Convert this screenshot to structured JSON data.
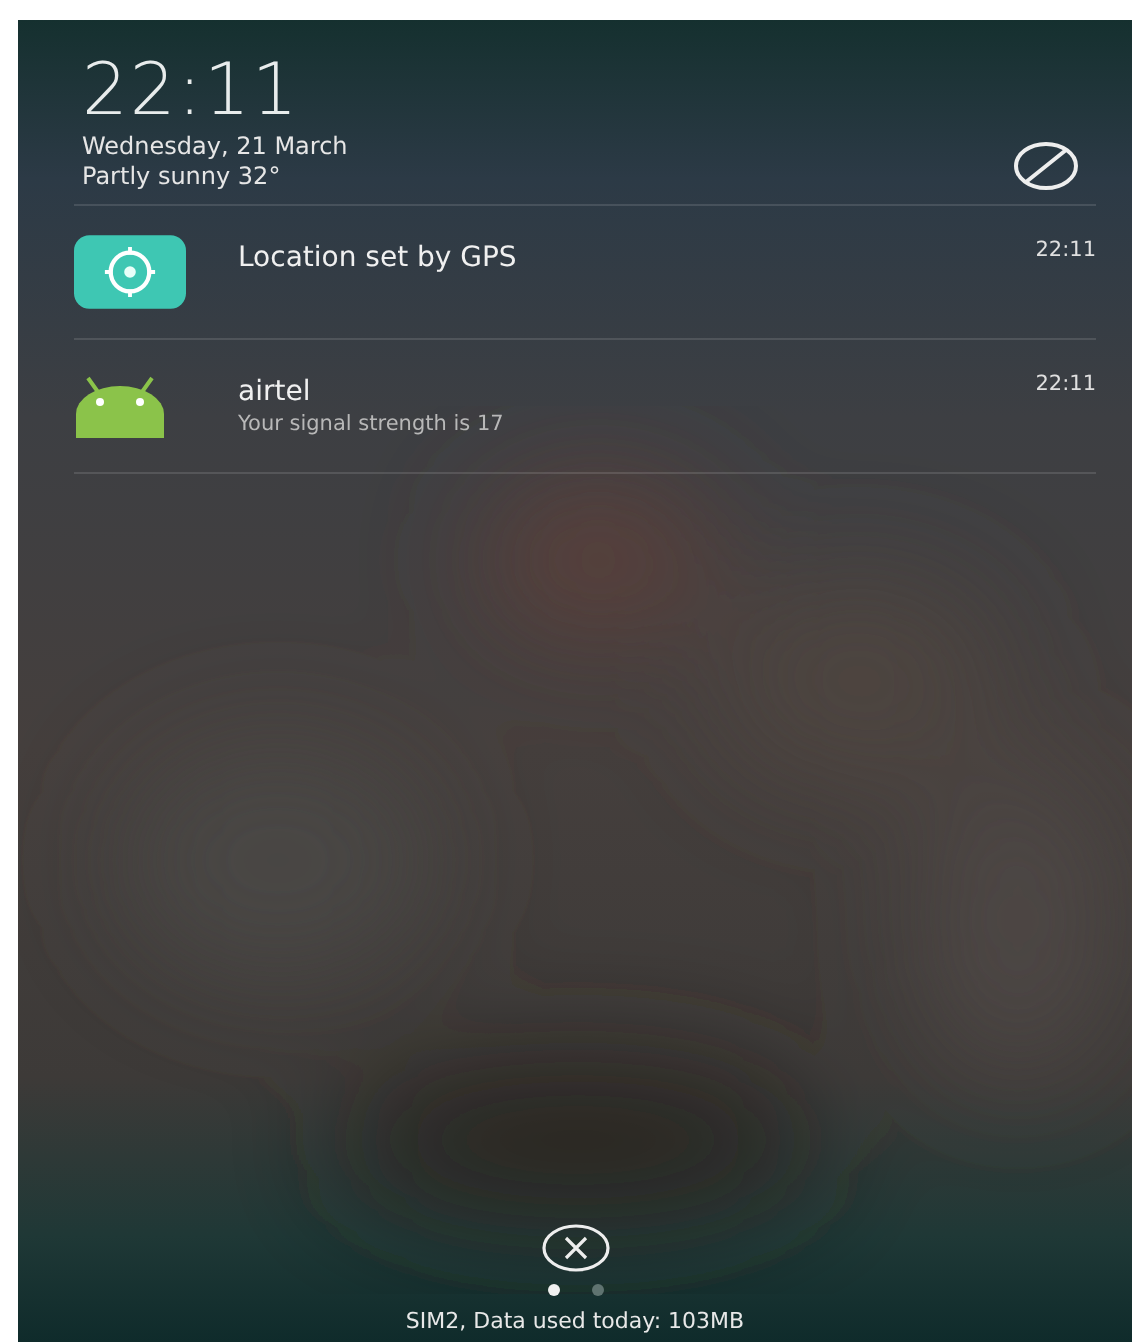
{
  "lock_screen": {
    "time": "22:11",
    "date": "Wednesday, 21 March",
    "weather": "Partly sunny 32°"
  },
  "notifications": [
    {
      "kind": "gps",
      "title": "Location set by GPS",
      "time": "22:11"
    },
    {
      "kind": "android",
      "title": "airtel",
      "text": "Your signal strength is 17",
      "time": "22:11"
    }
  ],
  "page_dots": [
    {
      "selected": true
    },
    {
      "selected": false
    }
  ],
  "status_bar": "SIM2, Data used today: 103MB"
}
